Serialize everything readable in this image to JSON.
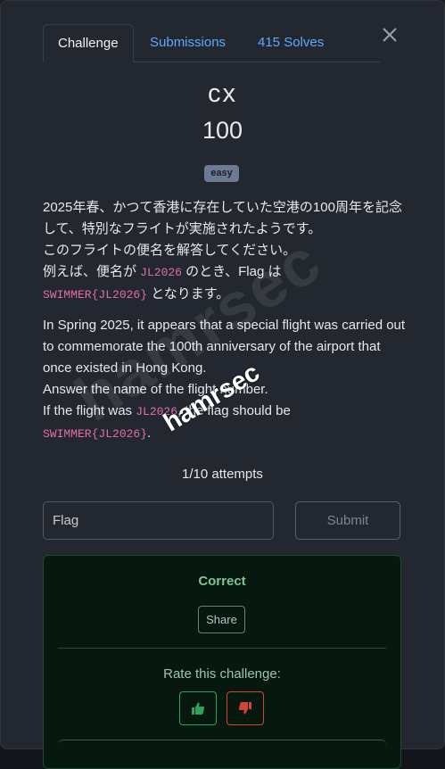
{
  "tabs": [
    {
      "label": "Challenge"
    },
    {
      "label": "Submissions"
    },
    {
      "label": "415 Solves"
    }
  ],
  "challenge": {
    "name": "cx",
    "points": "100",
    "difficulty": "easy"
  },
  "description": {
    "jp_line1": "2025年春、かつて香港に存在していた空港の100周年を記念して、特別なフライトが実施されたようです。",
    "jp_line2": "このフライトの便名を解答してください。",
    "jp_line3_a": "例えば、便名が ",
    "jp_line3_code": "JL2026",
    "jp_line3_b": " のとき、Flag は",
    "jp_line4_code": "SWIMMER{JL2026}",
    "jp_line4_b": " となります。",
    "en_line1": "In Spring 2025, it appears that a special flight was carried out to commemorate the 100th anniversary of the airport that once existed in Hong Kong.",
    "en_line2": "Answer the name of the flight number.",
    "en_line3_a": "If the flight was ",
    "en_line3_code": "JL2026",
    "en_line3_b": ", the flag should be",
    "en_line4_code": "SWIMMER{JL2026}",
    "en_line4_b": "."
  },
  "attempts": "1/10 attempts",
  "form": {
    "flag_placeholder": "Flag",
    "flag_value": "",
    "submit_label": "Submit"
  },
  "result": {
    "status": "Correct",
    "share_label": "Share",
    "rate_label": "Rate this challenge:"
  },
  "watermark": {
    "large": "hamrsec",
    "small": "hamrsec"
  },
  "colors": {
    "accent": "#5fa8ff",
    "code": "#e36dab",
    "correct": "#7cc596",
    "thumbs_up": "#2fa35d",
    "thumbs_down": "#d2453a"
  }
}
